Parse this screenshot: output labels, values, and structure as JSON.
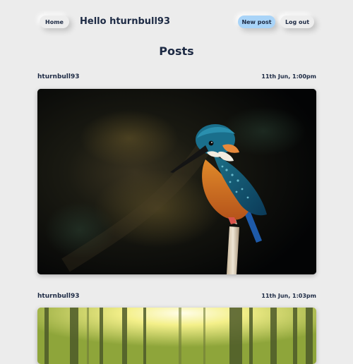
{
  "nav": {
    "home_label": "Home",
    "greeting": "Hello hturnbull93",
    "new_post_label": "New post",
    "logout_label": "Log out"
  },
  "page": {
    "title": "Posts"
  },
  "posts": [
    {
      "author": "hturnbull93",
      "timestamp": "11th Jun, 1:00pm",
      "image_subject": "kingfisher perched on a branch against a dark background"
    },
    {
      "author": "hturnbull93",
      "timestamp": "11th Jun, 1:03pm",
      "image_subject": "sunlit forest with tall trees"
    }
  ],
  "colors": {
    "background": "#ececec",
    "text": "#1d2a44",
    "accent_button": "#a9d4f8"
  }
}
